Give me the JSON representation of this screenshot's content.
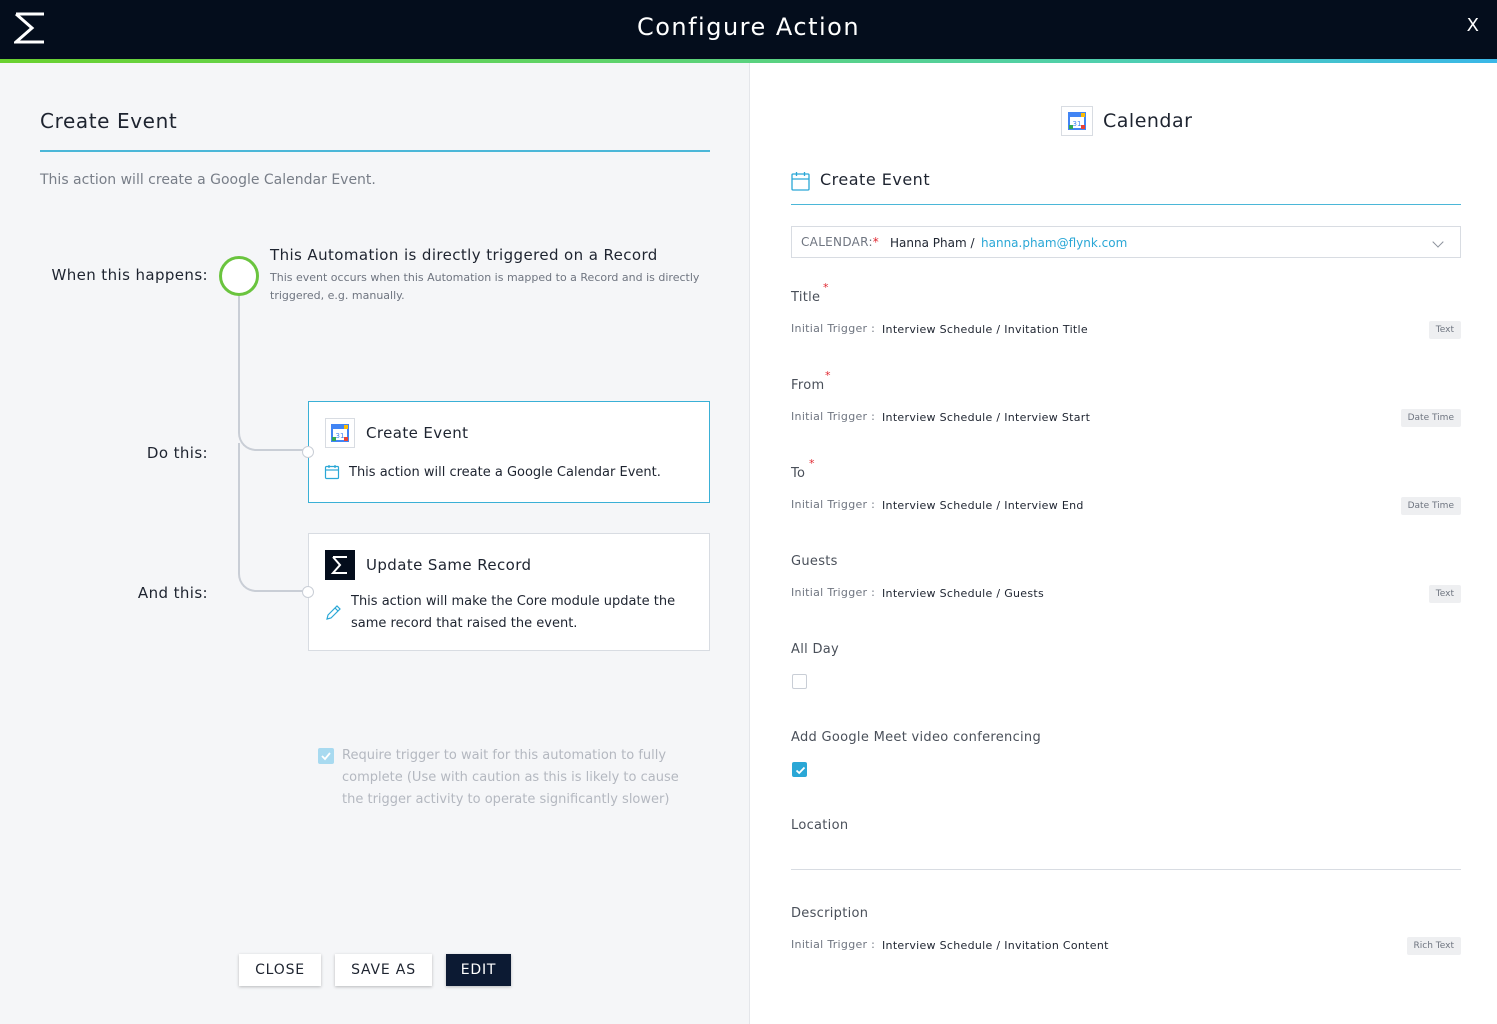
{
  "header": {
    "title": "Configure Action",
    "close_label": "X"
  },
  "left": {
    "title": "Create Event",
    "description": "This action will create a Google Calendar Event.",
    "labels": {
      "when": "When this happens:",
      "do": "Do this:",
      "and": "And this:"
    },
    "trigger": {
      "title": "This Automation is directly triggered on a Record",
      "subtitle": "This event occurs when this Automation is mapped to a Record and is directly triggered, e.g. manually."
    },
    "card_create": {
      "title": "Create Event",
      "description": "This action will create a Google Calendar Event."
    },
    "card_update": {
      "title": "Update Same Record",
      "description": "This action will make the Core module update the same record that raised the event."
    },
    "require_wait": {
      "checked": true,
      "text": "Require trigger to wait for this automation to fully complete (Use with caution as this is likely to cause the trigger activity to operate significantly slower)"
    },
    "buttons": {
      "close": "CLOSE",
      "save_as": "SAVE AS",
      "edit": "EDIT"
    }
  },
  "right": {
    "app_name": "Calendar",
    "section_title": "Create Event",
    "calendar": {
      "label": "CALENDAR:",
      "required": "*",
      "name": "Hanna Pham /",
      "email": "hanna.pham@flynk.com"
    },
    "fields": {
      "title": {
        "label": "Title",
        "required": "*",
        "prefix": "Initial Trigger :",
        "value": "Interview Schedule / Invitation Title",
        "type": "Text"
      },
      "from": {
        "label": "From",
        "required": "*",
        "prefix": "Initial Trigger :",
        "value": "Interview Schedule / Interview Start",
        "type": "Date Time"
      },
      "to": {
        "label": "To",
        "required": "*",
        "prefix": "Initial Trigger :",
        "value": "Interview Schedule / Interview End",
        "type": "Date Time"
      },
      "guests": {
        "label": "Guests",
        "prefix": "Initial Trigger :",
        "value": "Interview Schedule / Guests",
        "type": "Text"
      },
      "all_day": {
        "label": "All Day",
        "checked": false
      },
      "meet": {
        "label": "Add Google Meet video conferencing",
        "checked": true
      },
      "location": {
        "label": "Location"
      },
      "description": {
        "label": "Description",
        "prefix": "Initial Trigger :",
        "value": "Interview Schedule / Invitation Content",
        "type": "Rich Text"
      }
    }
  },
  "colors": {
    "accent": "#2aa7d6",
    "header_bg": "#040d1c",
    "trigger_green": "#6ac43e",
    "required": "#e0262f"
  }
}
